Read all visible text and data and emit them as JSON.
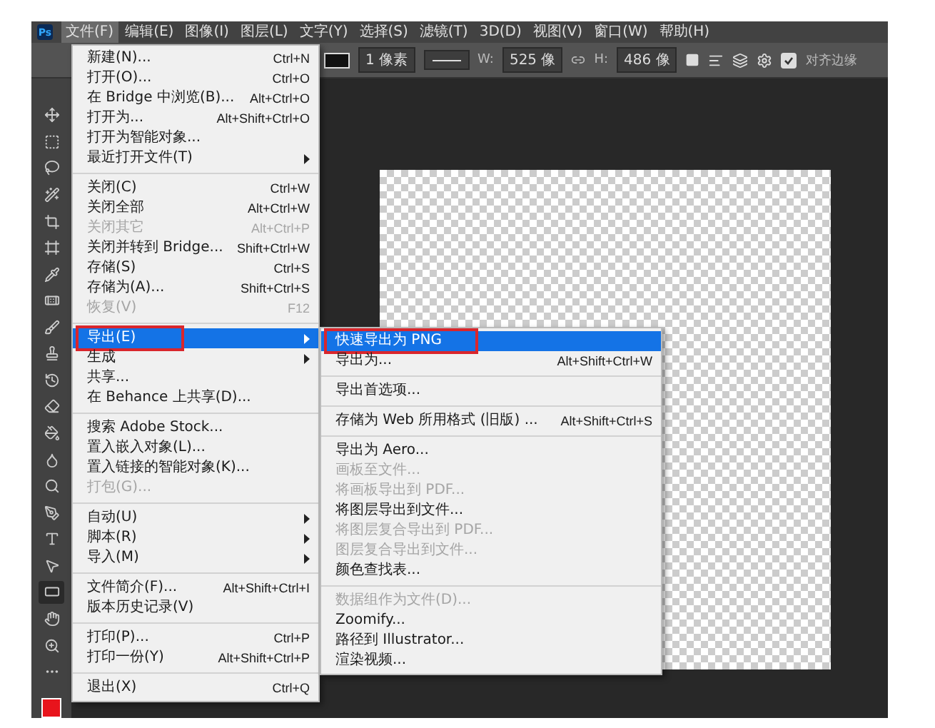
{
  "app_logo": "Ps",
  "menu_bar": [
    {
      "label": "文件(F)",
      "selected": true
    },
    {
      "label": "编辑(E)",
      "selected": false
    },
    {
      "label": "图像(I)",
      "selected": false
    },
    {
      "label": "图层(L)",
      "selected": false
    },
    {
      "label": "文字(Y)",
      "selected": false
    },
    {
      "label": "选择(S)",
      "selected": false
    },
    {
      "label": "滤镜(T)",
      "selected": false
    },
    {
      "label": "3D(D)",
      "selected": false
    },
    {
      "label": "视图(V)",
      "selected": false
    },
    {
      "label": "窗口(W)",
      "selected": false
    },
    {
      "label": "帮助(H)",
      "selected": false
    }
  ],
  "options_bar": {
    "stroke_width": "1 像素",
    "w_label": "W:",
    "w_value": "525 像",
    "h_label": "H:",
    "h_value": "486 像",
    "align_edges": {
      "label": "对齐边缘",
      "checked": true
    }
  },
  "tools": [
    {
      "kind": "move",
      "selected": false
    },
    {
      "kind": "marquee",
      "selected": false
    },
    {
      "kind": "lasso",
      "selected": false
    },
    {
      "kind": "wand",
      "selected": false
    },
    {
      "kind": "crop",
      "selected": false
    },
    {
      "kind": "frame",
      "selected": false
    },
    {
      "kind": "eyedropper",
      "selected": false
    },
    {
      "kind": "bandage",
      "selected": false
    },
    {
      "kind": "brush",
      "selected": false
    },
    {
      "kind": "stamp",
      "selected": false
    },
    {
      "kind": "history",
      "selected": false
    },
    {
      "kind": "eraser",
      "selected": false
    },
    {
      "kind": "bucket",
      "selected": false
    },
    {
      "kind": "droplet",
      "selected": false
    },
    {
      "kind": "dodge",
      "selected": false
    },
    {
      "kind": "pen",
      "selected": false
    },
    {
      "kind": "type",
      "selected": false
    },
    {
      "kind": "pointer",
      "selected": false
    },
    {
      "kind": "rectangle",
      "selected": true
    },
    {
      "kind": "hand",
      "selected": false
    },
    {
      "kind": "zoom",
      "selected": false
    },
    {
      "kind": "more",
      "selected": false
    }
  ],
  "file_menu": [
    {
      "kind": "item",
      "label": "新建(N)...",
      "shortcut": "Ctrl+N",
      "disabled": false,
      "submenu": false,
      "selected": false,
      "annotated": false
    },
    {
      "kind": "item",
      "label": "打开(O)...",
      "shortcut": "Ctrl+O",
      "disabled": false,
      "submenu": false,
      "selected": false,
      "annotated": false
    },
    {
      "kind": "item",
      "label": "在 Bridge 中浏览(B)...",
      "shortcut": "Alt+Ctrl+O",
      "disabled": false,
      "submenu": false,
      "selected": false,
      "annotated": false
    },
    {
      "kind": "item",
      "label": "打开为...",
      "shortcut": "Alt+Shift+Ctrl+O",
      "disabled": false,
      "submenu": false,
      "selected": false,
      "annotated": false
    },
    {
      "kind": "item",
      "label": "打开为智能对象...",
      "disabled": false,
      "submenu": false,
      "selected": false,
      "annotated": false
    },
    {
      "kind": "item",
      "label": "最近打开文件(T)",
      "disabled": false,
      "submenu": true,
      "selected": false,
      "annotated": false
    },
    {
      "kind": "separator"
    },
    {
      "kind": "item",
      "label": "关闭(C)",
      "shortcut": "Ctrl+W",
      "disabled": false,
      "submenu": false,
      "selected": false,
      "annotated": false
    },
    {
      "kind": "item",
      "label": "关闭全部",
      "shortcut": "Alt+Ctrl+W",
      "disabled": false,
      "submenu": false,
      "selected": false,
      "annotated": false
    },
    {
      "kind": "item",
      "label": "关闭其它",
      "shortcut": "Alt+Ctrl+P",
      "disabled": true,
      "submenu": false,
      "selected": false,
      "annotated": false
    },
    {
      "kind": "item",
      "label": "关闭并转到 Bridge...",
      "shortcut": "Shift+Ctrl+W",
      "disabled": false,
      "submenu": false,
      "selected": false,
      "annotated": false
    },
    {
      "kind": "item",
      "label": "存储(S)",
      "shortcut": "Ctrl+S",
      "disabled": false,
      "submenu": false,
      "selected": false,
      "annotated": false
    },
    {
      "kind": "item",
      "label": "存储为(A)...",
      "shortcut": "Shift+Ctrl+S",
      "disabled": false,
      "submenu": false,
      "selected": false,
      "annotated": false
    },
    {
      "kind": "item",
      "label": "恢复(V)",
      "shortcut": "F12",
      "disabled": true,
      "submenu": false,
      "selected": false,
      "annotated": false
    },
    {
      "kind": "separator"
    },
    {
      "kind": "item",
      "label": "导出(E)",
      "disabled": false,
      "submenu": true,
      "selected": true,
      "annotated": true
    },
    {
      "kind": "item",
      "label": "生成",
      "disabled": false,
      "submenu": true,
      "selected": false,
      "annotated": false
    },
    {
      "kind": "item",
      "label": "共享...",
      "disabled": false,
      "submenu": false,
      "selected": false,
      "annotated": false
    },
    {
      "kind": "item",
      "label": "在 Behance 上共享(D)...",
      "disabled": false,
      "submenu": false,
      "selected": false,
      "annotated": false
    },
    {
      "kind": "separator"
    },
    {
      "kind": "item",
      "label": "搜索 Adobe Stock...",
      "disabled": false,
      "submenu": false,
      "selected": false,
      "annotated": false
    },
    {
      "kind": "item",
      "label": "置入嵌入对象(L)...",
      "disabled": false,
      "submenu": false,
      "selected": false,
      "annotated": false
    },
    {
      "kind": "item",
      "label": "置入链接的智能对象(K)...",
      "disabled": false,
      "submenu": false,
      "selected": false,
      "annotated": false
    },
    {
      "kind": "item",
      "label": "打包(G)...",
      "disabled": true,
      "submenu": false,
      "selected": false,
      "annotated": false
    },
    {
      "kind": "separator"
    },
    {
      "kind": "item",
      "label": "自动(U)",
      "disabled": false,
      "submenu": true,
      "selected": false,
      "annotated": false
    },
    {
      "kind": "item",
      "label": "脚本(R)",
      "disabled": false,
      "submenu": true,
      "selected": false,
      "annotated": false
    },
    {
      "kind": "item",
      "label": "导入(M)",
      "disabled": false,
      "submenu": true,
      "selected": false,
      "annotated": false
    },
    {
      "kind": "separator"
    },
    {
      "kind": "item",
      "label": "文件简介(F)...",
      "shortcut": "Alt+Shift+Ctrl+I",
      "disabled": false,
      "submenu": false,
      "selected": false,
      "annotated": false
    },
    {
      "kind": "item",
      "label": "版本历史记录(V)",
      "disabled": false,
      "submenu": false,
      "selected": false,
      "annotated": false
    },
    {
      "kind": "separator"
    },
    {
      "kind": "item",
      "label": "打印(P)...",
      "shortcut": "Ctrl+P",
      "disabled": false,
      "submenu": false,
      "selected": false,
      "annotated": false
    },
    {
      "kind": "item",
      "label": "打印一份(Y)",
      "shortcut": "Alt+Shift+Ctrl+P",
      "disabled": false,
      "submenu": false,
      "selected": false,
      "annotated": false
    },
    {
      "kind": "separator"
    },
    {
      "kind": "item",
      "label": "退出(X)",
      "shortcut": "Ctrl+Q",
      "disabled": false,
      "submenu": false,
      "selected": false,
      "annotated": false
    }
  ],
  "export_submenu": [
    {
      "kind": "item",
      "label": "快速导出为 PNG",
      "disabled": false,
      "submenu": false,
      "selected": true,
      "annotated": true
    },
    {
      "kind": "item",
      "label": "导出为...",
      "shortcut": "Alt+Shift+Ctrl+W",
      "disabled": false,
      "submenu": false,
      "selected": false,
      "annotated": false
    },
    {
      "kind": "separator"
    },
    {
      "kind": "item",
      "label": "导出首选项...",
      "disabled": false,
      "submenu": false,
      "selected": false,
      "annotated": false
    },
    {
      "kind": "separator"
    },
    {
      "kind": "item",
      "label": "存储为 Web 所用格式 (旧版) ...",
      "shortcut": "Alt+Shift+Ctrl+S",
      "disabled": false,
      "submenu": false,
      "selected": false,
      "annotated": false
    },
    {
      "kind": "separator"
    },
    {
      "kind": "item",
      "label": "导出为 Aero...",
      "disabled": false,
      "submenu": false,
      "selected": false,
      "annotated": false
    },
    {
      "kind": "item",
      "label": "画板至文件...",
      "disabled": true,
      "submenu": false,
      "selected": false,
      "annotated": false
    },
    {
      "kind": "item",
      "label": "将画板导出到 PDF...",
      "disabled": true,
      "submenu": false,
      "selected": false,
      "annotated": false
    },
    {
      "kind": "item",
      "label": "将图层导出到文件...",
      "disabled": false,
      "submenu": false,
      "selected": false,
      "annotated": false
    },
    {
      "kind": "item",
      "label": "将图层复合导出到 PDF...",
      "disabled": true,
      "submenu": false,
      "selected": false,
      "annotated": false
    },
    {
      "kind": "item",
      "label": "图层复合导出到文件...",
      "disabled": true,
      "submenu": false,
      "selected": false,
      "annotated": false
    },
    {
      "kind": "item",
      "label": "颜色查找表...",
      "disabled": false,
      "submenu": false,
      "selected": false,
      "annotated": false
    },
    {
      "kind": "separator"
    },
    {
      "kind": "item",
      "label": "数据组作为文件(D)...",
      "disabled": true,
      "submenu": false,
      "selected": false,
      "annotated": false
    },
    {
      "kind": "item",
      "label": "Zoomify...",
      "disabled": false,
      "submenu": false,
      "selected": false,
      "annotated": false
    },
    {
      "kind": "item",
      "label": "路径到 Illustrator...",
      "disabled": false,
      "submenu": false,
      "selected": false,
      "annotated": false
    },
    {
      "kind": "item",
      "label": "渲染视频...",
      "disabled": false,
      "submenu": false,
      "selected": false,
      "annotated": false
    }
  ]
}
